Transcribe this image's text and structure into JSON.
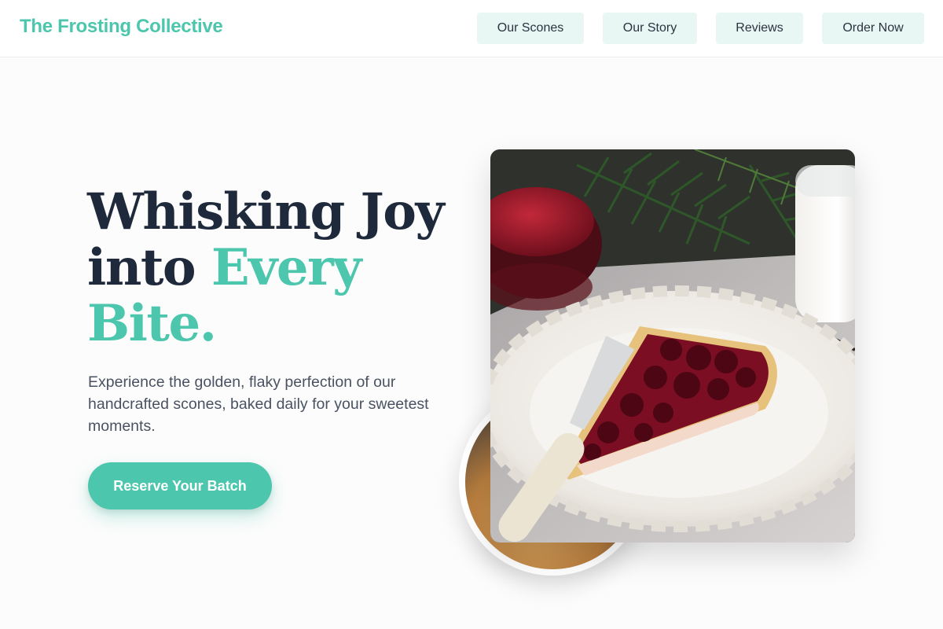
{
  "header": {
    "logo": "The Frosting Collective",
    "nav": [
      {
        "label": "Our Scones"
      },
      {
        "label": "Our Story"
      },
      {
        "label": "Reviews"
      },
      {
        "label": "Order Now"
      }
    ]
  },
  "hero": {
    "headline_line1": "Whisking Joy",
    "headline_line2_plain": "into ",
    "headline_line2_accent": "Every",
    "headline_line3_accent": "Bite.",
    "tagline": "Experience the golden, flaky perfection of our handcrafted scones, baked daily for your sweetest moments.",
    "cta_label": "Reserve Your Batch",
    "main_image": "cherry-tart-slice-photo",
    "secondary_image": "baked-scone-photo"
  },
  "colors": {
    "accent": "#4cc6ad",
    "heading": "#1e2a3b",
    "body_text": "#4a5262",
    "nav_bg": "#e8f7f3"
  }
}
